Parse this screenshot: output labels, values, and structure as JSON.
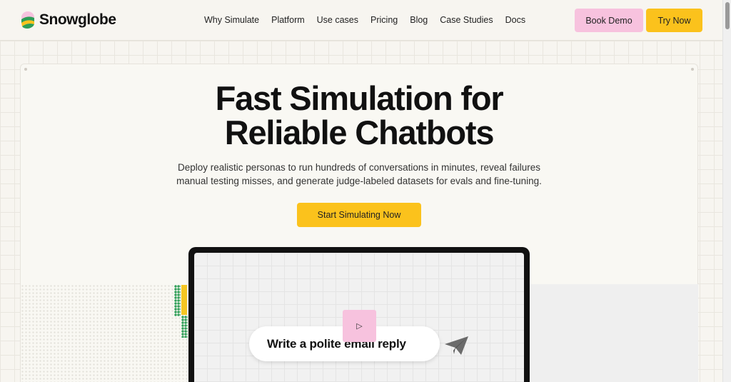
{
  "brand": {
    "name": "Snowglobe"
  },
  "nav": {
    "links": [
      "Why Simulate",
      "Platform",
      "Use cases",
      "Pricing",
      "Blog",
      "Case Studies",
      "Docs"
    ],
    "book_demo": "Book Demo",
    "try_now": "Try Now"
  },
  "hero": {
    "title_line1": "Fast Simulation for",
    "title_line2": "Reliable Chatbots",
    "sub_line1": "Deploy realistic personas to run hundreds of conversations in minutes, reveal failures",
    "sub_line2": "manual testing misses, and generate judge-labeled datasets for evals and fine-tuning.",
    "cta": "Start Simulating Now"
  },
  "demo": {
    "prompt_text": "Write a polite email reply",
    "play_icon": "play-icon",
    "send_icon": "paper-plane-icon"
  },
  "colors": {
    "accent_yellow": "#fbc21c",
    "accent_pink": "#f7c2de",
    "background": "#f7f5f0",
    "green": "#2e9e57"
  }
}
